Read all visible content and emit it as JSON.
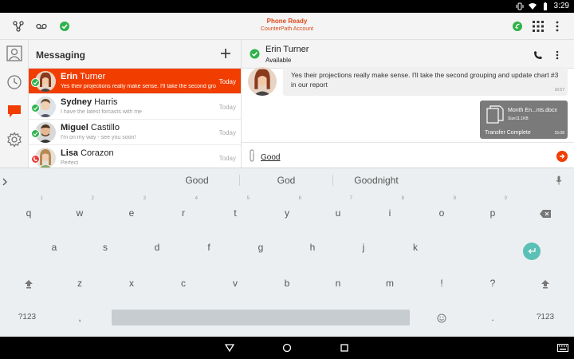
{
  "status_bar": {
    "time": "3:29"
  },
  "header": {
    "status_title": "Phone Ready",
    "status_subtitle": "CounterPath Account",
    "accent": "#f23d00"
  },
  "messaging": {
    "title": "Messaging",
    "conversations": [
      {
        "first": "Erin",
        "last": "Turner",
        "preview": "Yes their projections really make sense. I'll take the second grouping...",
        "time": "Today",
        "presence": "available",
        "active": true
      },
      {
        "first": "Sydney",
        "last": "Harris",
        "preview": "I have the latest forcasts with me",
        "time": "Today",
        "presence": "available",
        "active": false
      },
      {
        "first": "Miguel",
        "last": "Castillo",
        "preview": "I'm on my way - see you soon!",
        "time": "Today",
        "presence": "available",
        "active": false
      },
      {
        "first": "Lisa",
        "last": "Corazon",
        "preview": "Perfect",
        "time": "Today",
        "presence": "on-call",
        "active": false
      }
    ]
  },
  "chat": {
    "contact_name": "Erin Turner",
    "contact_status": "Available",
    "message": {
      "text": "Yes their projections really make sense. I'll take the second grouping and update chart #3 in our report",
      "time": "16:57"
    },
    "file": {
      "name": "Month En...nts.docx",
      "size": "Size11.1KB",
      "status": "Transfer Complete",
      "time": "15:08"
    },
    "composer_text": "Good"
  },
  "keyboard": {
    "suggestions": [
      "Good",
      "God",
      "Goodnight"
    ],
    "row1": [
      {
        "k": "q",
        "n": "1"
      },
      {
        "k": "w",
        "n": "2"
      },
      {
        "k": "e",
        "n": "3"
      },
      {
        "k": "r",
        "n": "4"
      },
      {
        "k": "t",
        "n": "5"
      },
      {
        "k": "y",
        "n": "6"
      },
      {
        "k": "u",
        "n": "7"
      },
      {
        "k": "i",
        "n": "8"
      },
      {
        "k": "o",
        "n": "9"
      },
      {
        "k": "p",
        "n": "0"
      }
    ],
    "row2": [
      "a",
      "s",
      "d",
      "f",
      "g",
      "h",
      "j",
      "k"
    ],
    "row3": [
      "z",
      "x",
      "c",
      "v",
      "b",
      "n",
      "m",
      "!",
      "?"
    ],
    "sym_label": "?123",
    "comma": ",",
    "period": "."
  }
}
